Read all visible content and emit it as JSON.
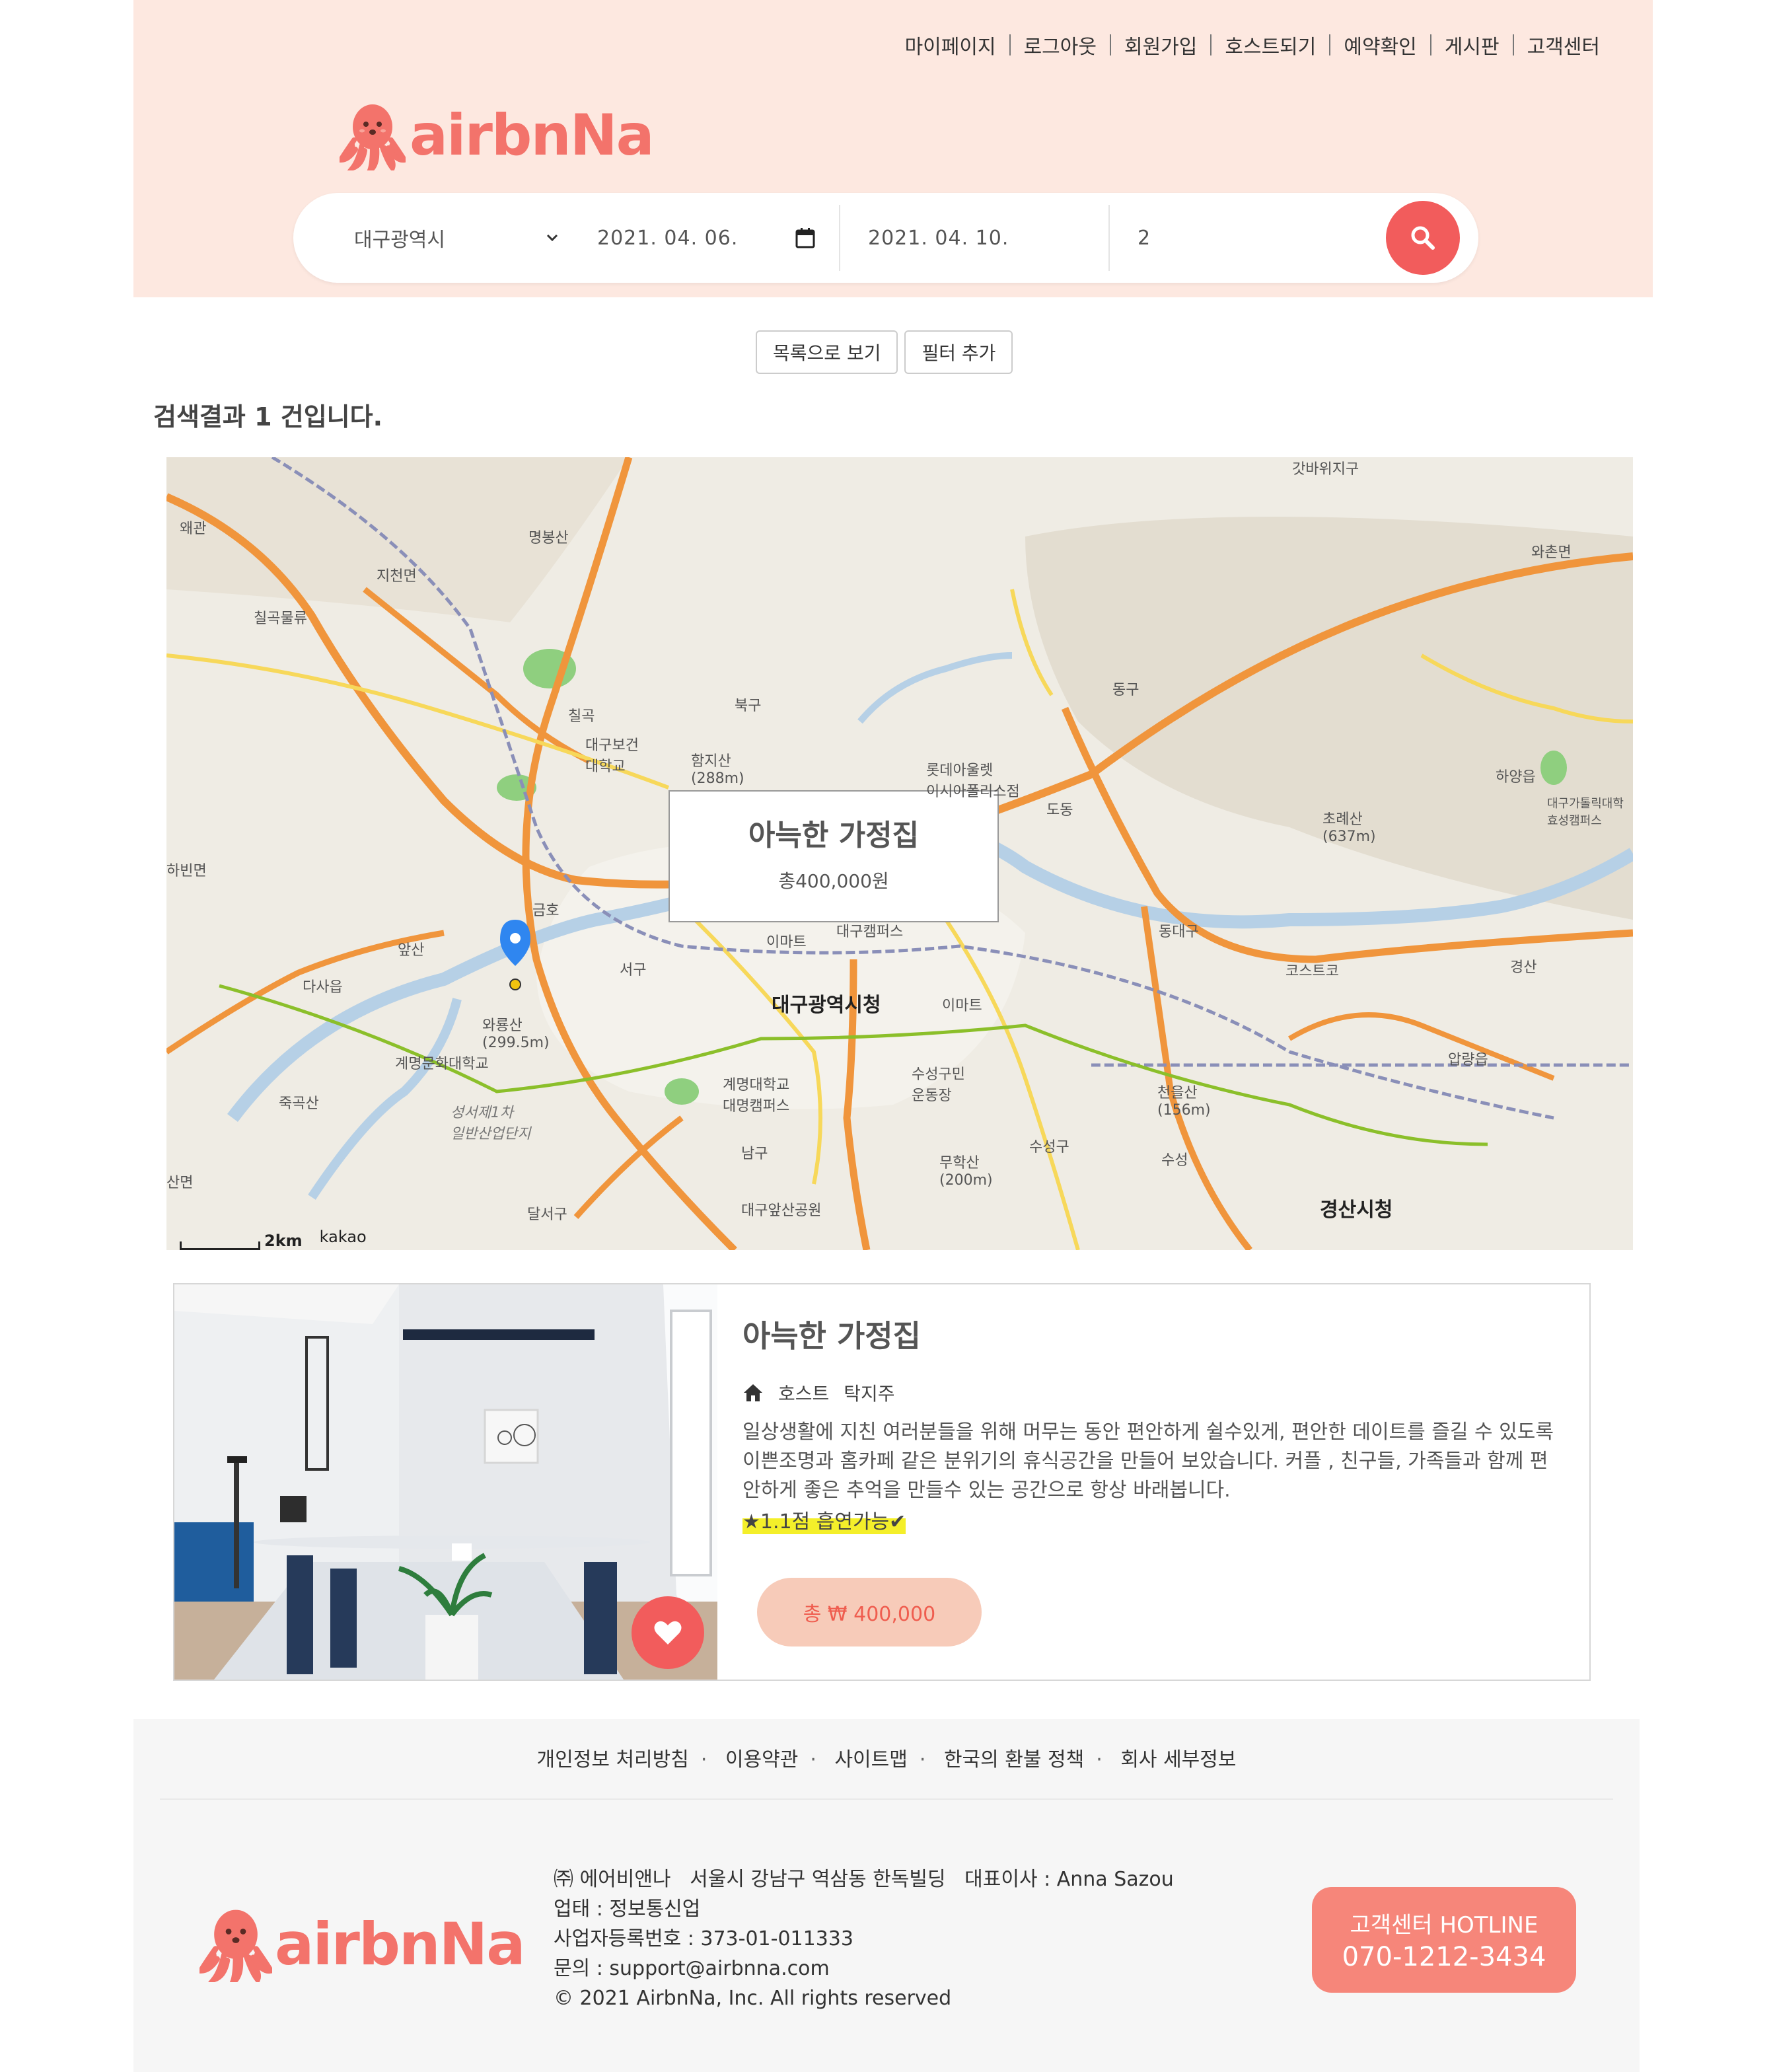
{
  "topnav": [
    "마이페이지",
    "로그아웃",
    "회원가입",
    "호스트되기",
    "예약확인",
    "게시판",
    "고객센터"
  ],
  "brand": {
    "name": "airbnNa",
    "color": "#f3736b"
  },
  "search": {
    "city": "대구광역시",
    "checkin": "2021. 04. 06.",
    "checkout": "2021. 04. 10.",
    "guests": "2"
  },
  "controls": {
    "list_view": "목록으로 보기",
    "add_filter": "필터 추가"
  },
  "result_text": "검색결과 1 건입니다.",
  "map": {
    "popup_title": "아늑한 가정집",
    "popup_price": "총400,000원",
    "scale": "2km",
    "provider": "kakao",
    "labels": {
      "l1": "대구광역시청",
      "l2": "북구",
      "l3": "서구",
      "l4": "남구",
      "l5": "동구",
      "l6": "수성구",
      "l7": "달서구",
      "l8": "경산시청",
      "l9": "초례산\n(637m)",
      "l10": "함지산\n(288m)",
      "l11": "이마트",
      "l12": "이마트",
      "l13": "코스트코",
      "l14": "하양읍",
      "l15": "와촌면",
      "l16": "갓바위지구",
      "l17": "명봉산",
      "l18": "지천면",
      "l19": "칠곡물류",
      "l20": "왜관",
      "l21": "하빈면",
      "l22": "다사읍",
      "l23": "앞산",
      "l24": "와룡산\n(299.5m)",
      "l25": "죽곡산",
      "l26": "계명문화대학교",
      "l27": "계명대학교\n대명캠퍼스",
      "l28": "수성구민\n운동장",
      "l29": "무학산\n(200m)",
      "l30": "대구앞산공원",
      "l31": "성서제1차\n일반산업단지",
      "l32": "롯데아울렛\n이시아폴리스점",
      "l33": "대구보건\n대학교",
      "l34": "칠곡",
      "l35": "금호",
      "l36": "동대구",
      "l37": "수성",
      "l38": "천을산\n(156m)",
      "l39": "압량읍",
      "l40": "산면",
      "l41": "도동",
      "l42": "대구캠퍼스",
      "l43": "경산",
      "l44": "대구가톨릭대학\n효성캠퍼스"
    }
  },
  "listing": {
    "title": "아늑한 가정집",
    "host_label": "호스트",
    "host_name": "탁지주",
    "description": "일상생활에 지친 여러분들을 위해 머무는 동안 편안하게 쉴수있게, 편안한 데이트를 즐길 수 있도록 이쁜조명과 홈카페 같은 분위기의 휴식공간을 만들어 보았습니다. 커플 , 친구들, 가족들과 함께 편안하게 좋은 추억을 만들수 있는 공간으로 항상 바래봅니다.",
    "rating": "★1.1점 흡연가능✔",
    "price": "총 ₩ 400,000"
  },
  "footer": {
    "links": [
      "개인정보 처리방침",
      "이용약관",
      "사이트맵",
      "한국의 환불 정책",
      "회사 세부정보"
    ],
    "company_line": "㈜ 에어비앤나   서울시 강남구 역삼동 한독빌딩   대표이사 : Anna Sazou",
    "business": "업태 : 정보통신업",
    "reg_no": "사업자등록번호 : 373-01-011333",
    "contact": "문의 : support@airbnna.com",
    "copyright": "© 2021 AirbnNa, Inc. All rights reserved",
    "hotline_label": "고객센터 HOTLINE",
    "hotline_number": "070-1212-3434"
  }
}
